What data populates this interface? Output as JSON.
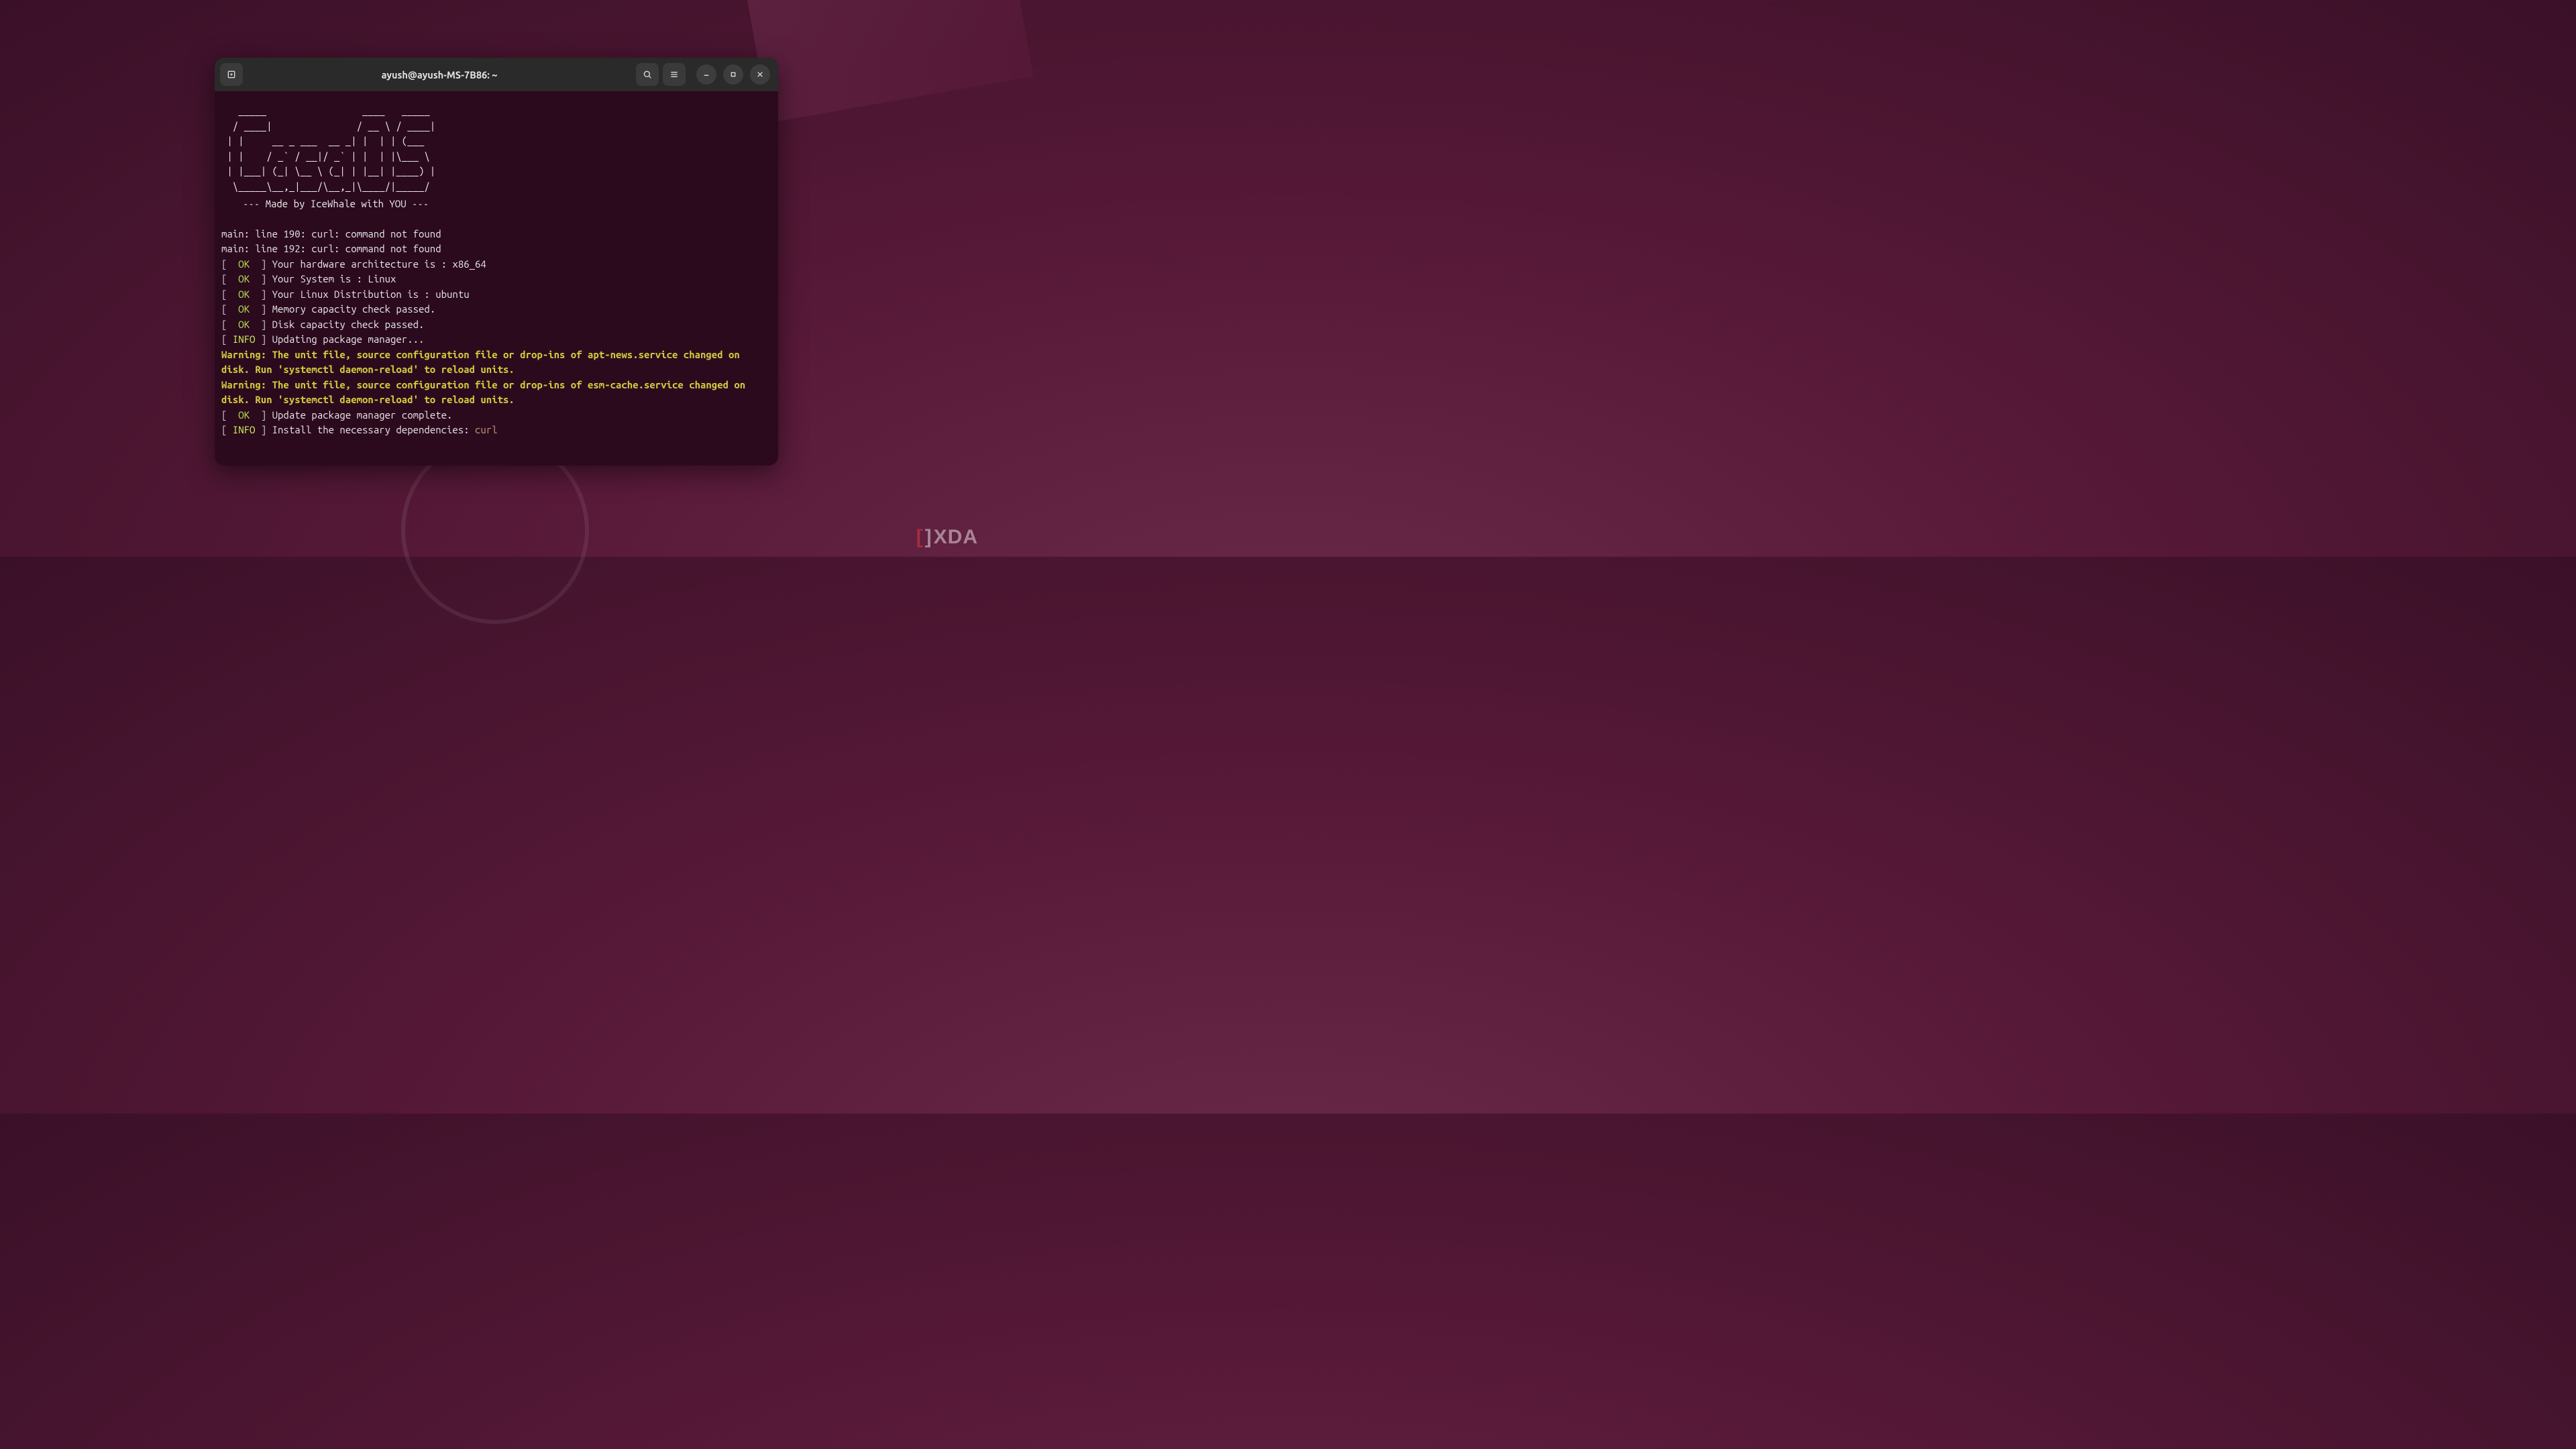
{
  "window": {
    "title": "ayush@ayush-MS-7B86: ~"
  },
  "ascii_art": "   _____                 ____   _____\n  / ____|               / __ \\ / ____|\n | |     __ _ ___  __ _| |  | | (___\n | |    / _` / __|/ _` | |  | |\\___ \\\n | |___| (_| \\__ \\ (_| | |__| |____) |\n  \\_____\\__,_|___/\\__,_|\\____/|_____/",
  "tagline": "--- Made by IceWhale with YOU ---",
  "lines": [
    {
      "type": "plain",
      "text": "main: line 190: curl: command not found"
    },
    {
      "type": "plain",
      "text": "main: line 192: curl: command not found"
    },
    {
      "type": "ok",
      "text": "Your hardware architecture is : x86_64"
    },
    {
      "type": "ok",
      "text": "Your System is : Linux"
    },
    {
      "type": "ok",
      "text": "Your Linux Distribution is : ubuntu"
    },
    {
      "type": "ok",
      "text": "Memory capacity check passed."
    },
    {
      "type": "ok",
      "text": "Disk capacity check passed."
    },
    {
      "type": "info",
      "text": "Updating package manager..."
    },
    {
      "type": "warn",
      "text": "Warning: The unit file, source configuration file or drop-ins of apt-news.service changed on disk. Run 'systemctl daemon-reload' to reload units."
    },
    {
      "type": "warn",
      "text": "Warning: The unit file, source configuration file or drop-ins of esm-cache.service changed on disk. Run 'systemctl daemon-reload' to reload units."
    },
    {
      "type": "ok",
      "text": "Update package manager complete."
    },
    {
      "type": "info_pkg",
      "text": "Install the necessary dependencies: ",
      "pkg": "curl"
    }
  ],
  "labels": {
    "ok": "  OK  ",
    "info": " INFO "
  },
  "watermark": {
    "bracket_l": "[",
    "bracket_r": "]",
    "text": "XDA"
  }
}
